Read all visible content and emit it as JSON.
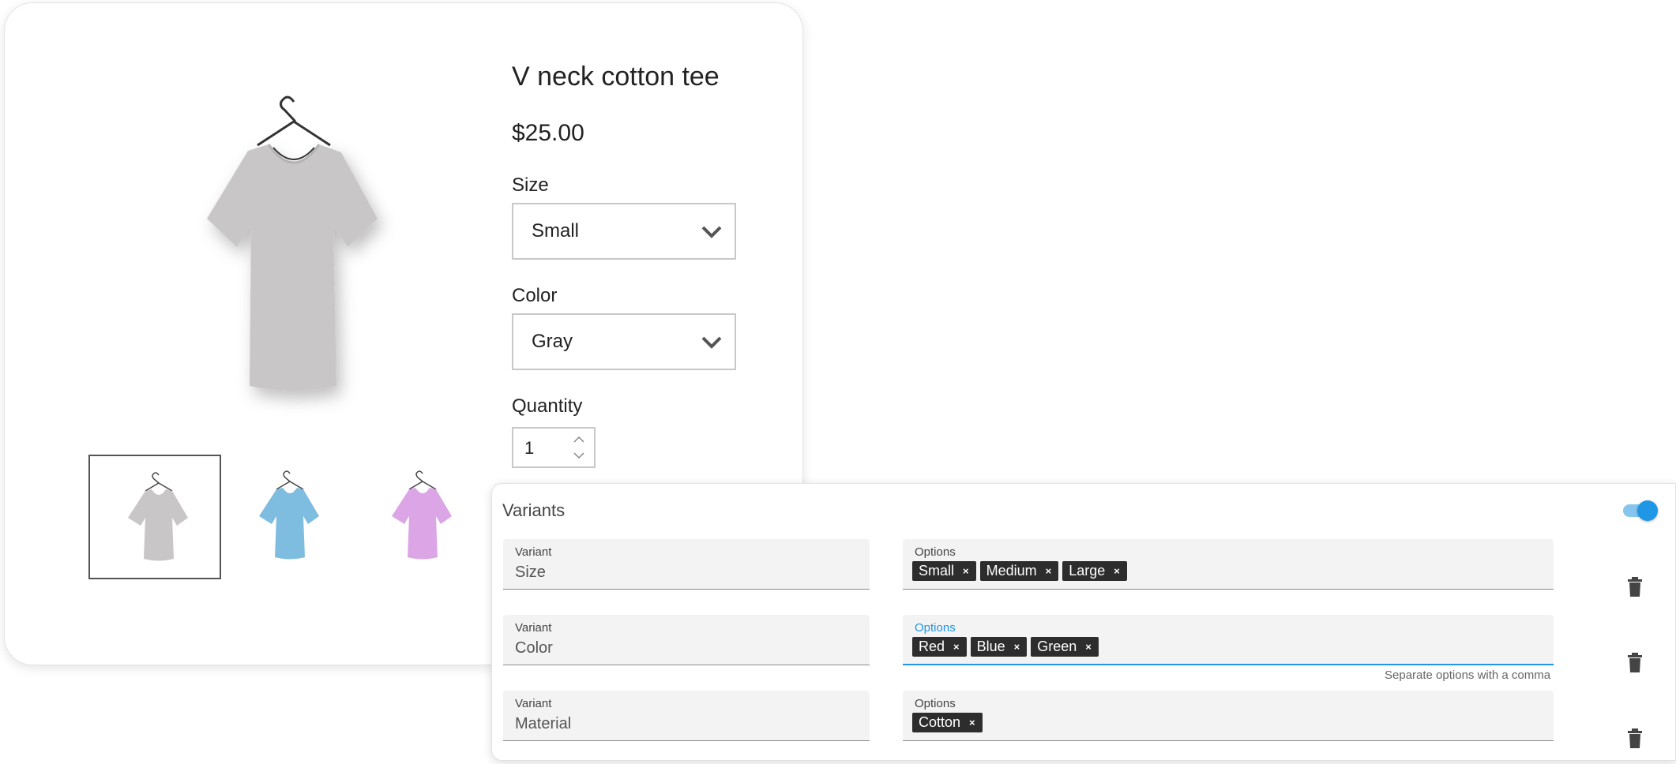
{
  "product": {
    "title": "V neck cotton tee",
    "price": "$25.00",
    "size": {
      "label": "Size",
      "value": "Small"
    },
    "color": {
      "label": "Color",
      "value": "Gray"
    },
    "quantity": {
      "label": "Quantity",
      "value": "1"
    },
    "thumbnails": [
      {
        "icon": "tshirt-gray-thumbnail",
        "color": "#c9c6c8",
        "selected": true
      },
      {
        "icon": "tshirt-blue-thumbnail",
        "color": "#7fbde0",
        "selected": false
      },
      {
        "icon": "tshirt-pink-thumbnail",
        "color": "#dca6e6",
        "selected": false
      }
    ],
    "main_image": {
      "icon": "tshirt-gray-image",
      "color": "#c9c6c8"
    }
  },
  "variants_panel": {
    "title": "Variants",
    "toggle_on": true,
    "accent_color": "#1f96e6",
    "variant_label": "Variant",
    "options_label": "Options",
    "hint": "Separate options with a comma",
    "rows": [
      {
        "variant": "Size",
        "options": [
          "Small",
          "Medium",
          "Large"
        ]
      },
      {
        "variant": "Color",
        "options": [
          "Red",
          "Blue",
          "Green"
        ]
      },
      {
        "variant": "Material",
        "options": [
          "Cotton"
        ]
      }
    ],
    "chip_remove_glyph": "×"
  }
}
